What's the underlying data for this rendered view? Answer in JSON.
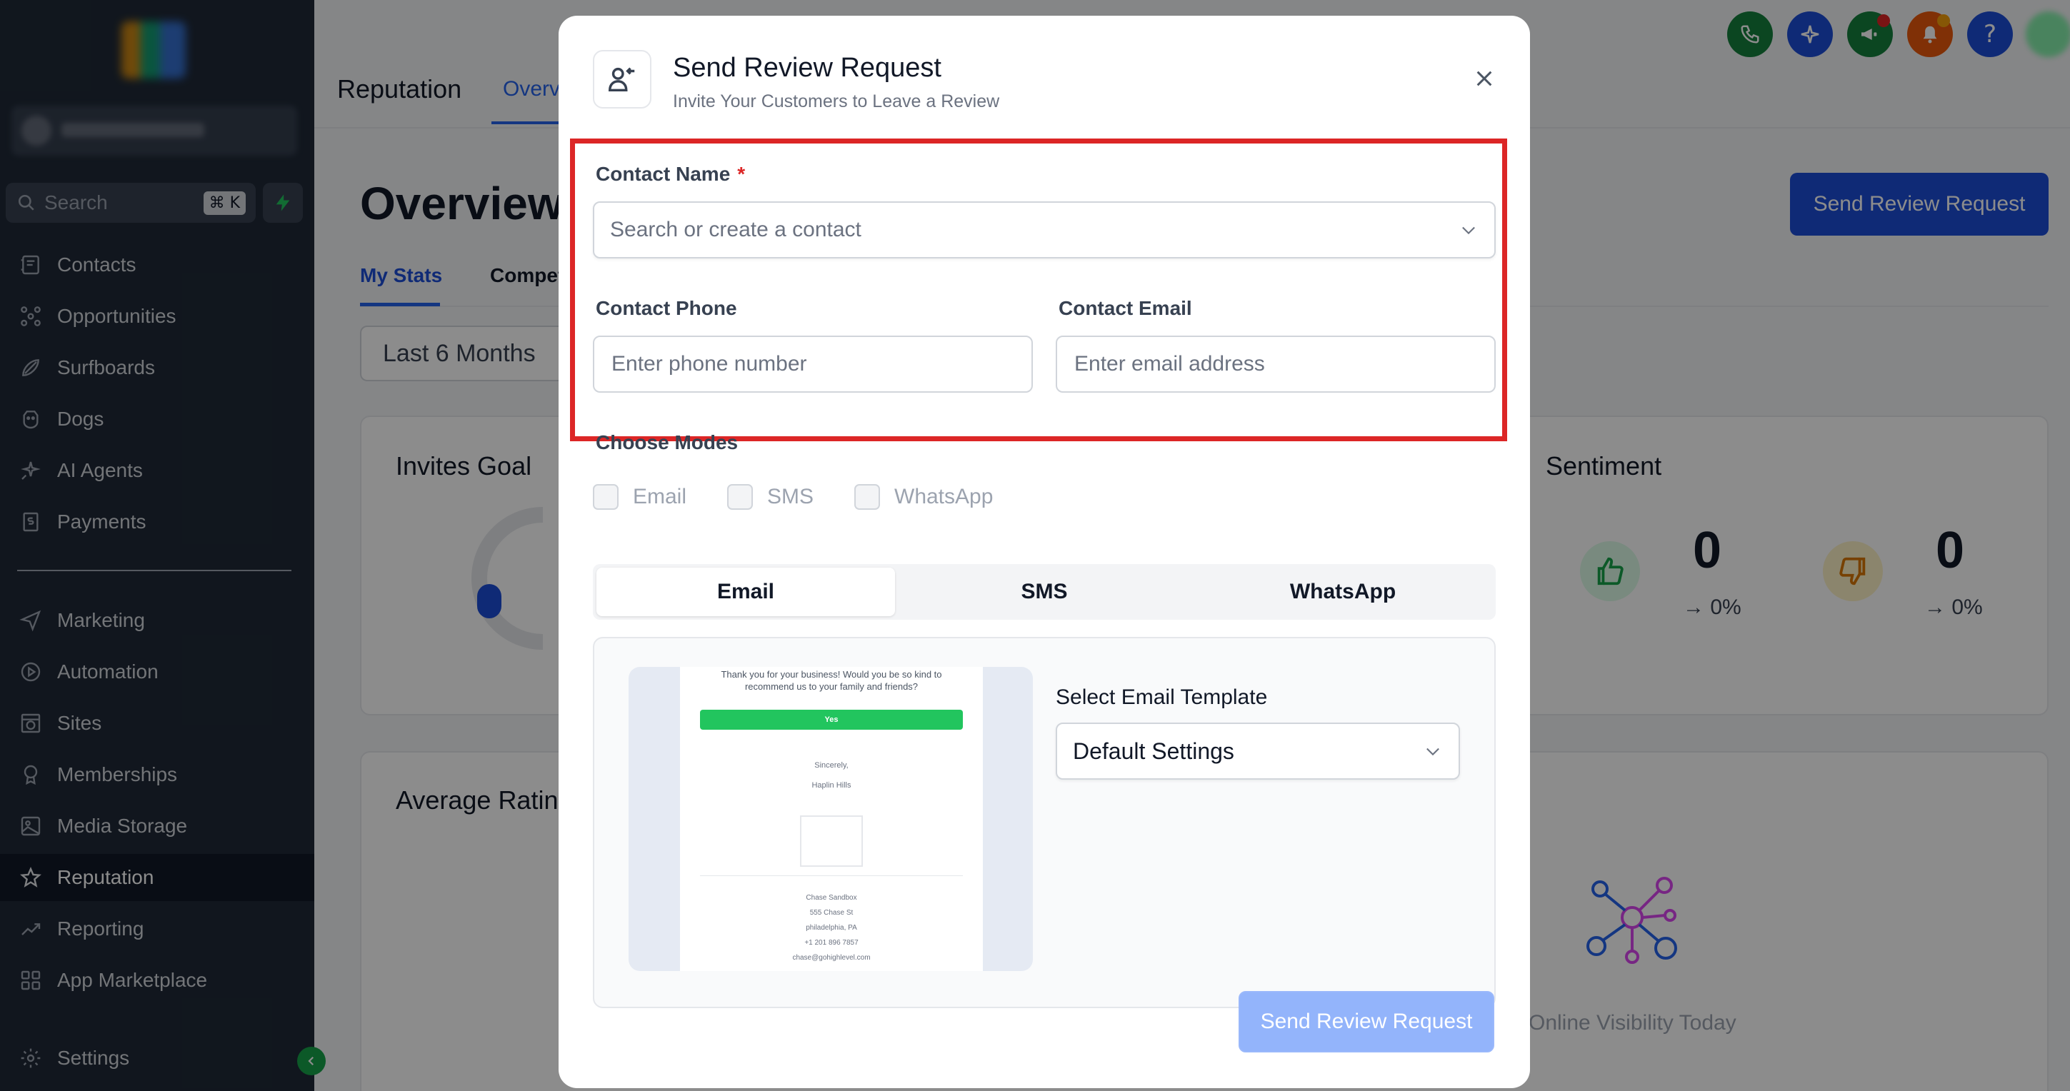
{
  "sidebar": {
    "search": {
      "placeholder": "Search",
      "shortcut": "⌘ K"
    },
    "items": [
      {
        "label": "Contacts",
        "icon": "contacts-icon"
      },
      {
        "label": "Opportunities",
        "icon": "opportunities-icon"
      },
      {
        "label": "Surfboards",
        "icon": "surfboard-icon"
      },
      {
        "label": "Dogs",
        "icon": "dog-icon"
      },
      {
        "label": "AI Agents",
        "icon": "sparkle-icon"
      },
      {
        "label": "Payments",
        "icon": "payments-icon"
      },
      {
        "label": "Marketing",
        "icon": "send-icon"
      },
      {
        "label": "Automation",
        "icon": "play-circle-icon"
      },
      {
        "label": "Sites",
        "icon": "globe-window-icon"
      },
      {
        "label": "Memberships",
        "icon": "membership-icon"
      },
      {
        "label": "Media Storage",
        "icon": "image-icon"
      },
      {
        "label": "Reputation",
        "icon": "star-icon",
        "active": true
      },
      {
        "label": "Reporting",
        "icon": "trend-icon"
      },
      {
        "label": "App Marketplace",
        "icon": "grid-icon"
      },
      {
        "label": "Settings",
        "icon": "gear-icon"
      }
    ]
  },
  "header": {
    "title": "Reputation",
    "active_tab": "Overvi"
  },
  "page": {
    "title": "Overview",
    "subtabs": [
      "My Stats",
      "Compet"
    ],
    "period": "Last 6 Months",
    "send_button": "Send Review Request",
    "cards": {
      "invites_goal": "Invites Goal",
      "sentiment": "Sentiment",
      "average_rating": "Average Ratin",
      "positive_value": "0",
      "positive_change": "→ 0%",
      "negative_value": "0",
      "negative_change": "→ 0%",
      "faded_caption": "Online Visibility Today"
    }
  },
  "modal": {
    "title": "Send Review Request",
    "subtitle": "Invite Your Customers to Leave a Review",
    "contact_name_label": "Contact Name",
    "required_mark": "*",
    "contact_name_placeholder": "Search or create a contact",
    "contact_phone_label": "Contact Phone",
    "contact_phone_placeholder": "Enter phone number",
    "contact_email_label": "Contact Email",
    "contact_email_placeholder": "Enter email address",
    "choose_modes_label": "Choose Modes",
    "modes": [
      "Email",
      "SMS",
      "WhatsApp"
    ],
    "mode_tabs": [
      "Email",
      "SMS",
      "WhatsApp"
    ],
    "active_mode_tab": "Email",
    "preview": {
      "thanks": "Thank you for your business! Would you be so kind to recommend us to your family and friends?",
      "yes": "Yes",
      "sincerely": "Sincerely,",
      "company": "Haplin Hills",
      "footer_name": "Chase Sandbox",
      "footer_street": "555 Chase St",
      "footer_city": "philadelphia, PA",
      "footer_phone": "+1 201 896 7857",
      "footer_email": "chase@gohighlevel.com"
    },
    "template_label": "Select Email Template",
    "template_value": "Default Settings",
    "submit": "Send Review Request"
  },
  "colors": {
    "brand_blue": "#1d4ed8",
    "highlight_red": "#dc2626",
    "sidebar_bg": "#1f2937"
  }
}
